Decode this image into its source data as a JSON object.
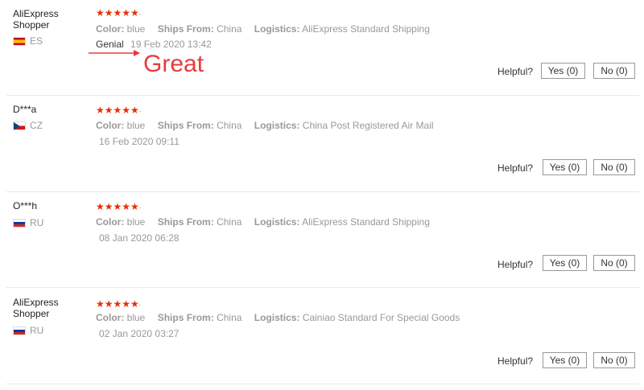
{
  "reviews": [
    {
      "user": "AliExpress\nShopper",
      "country_code": "ES",
      "rating_display": "★★★★★",
      "color_label": "Color:",
      "color_value": "blue",
      "ships_label": "Ships From:",
      "ships_value": "China",
      "logistics_label": "Logistics:",
      "logistics_value": "AliExpress Standard Shipping",
      "feedback_text": "Genial",
      "date": "19 Feb 2020 13:42",
      "helpful_label": "Helpful?",
      "yes_label": "Yes (0)",
      "no_label": "No (0)"
    },
    {
      "user": "D***a",
      "country_code": "CZ",
      "rating_display": "★★★★★",
      "color_label": "Color:",
      "color_value": "blue",
      "ships_label": "Ships From:",
      "ships_value": "China",
      "logistics_label": "Logistics:",
      "logistics_value": "China Post Registered Air Mail",
      "feedback_text": "",
      "date": "16 Feb 2020 09:11",
      "helpful_label": "Helpful?",
      "yes_label": "Yes (0)",
      "no_label": "No (0)"
    },
    {
      "user": "O***h",
      "country_code": "RU",
      "rating_display": "★★★★★",
      "color_label": "Color:",
      "color_value": "blue",
      "ships_label": "Ships From:",
      "ships_value": "China",
      "logistics_label": "Logistics:",
      "logistics_value": "AliExpress Standard Shipping",
      "feedback_text": "",
      "date": "08 Jan 2020 06:28",
      "helpful_label": "Helpful?",
      "yes_label": "Yes (0)",
      "no_label": "No (0)"
    },
    {
      "user": "AliExpress\nShopper",
      "country_code": "RU",
      "rating_display": "★★★★★",
      "color_label": "Color:",
      "color_value": "blue",
      "ships_label": "Ships From:",
      "ships_value": "China",
      "logistics_label": "Logistics:",
      "logistics_value": "Cainiao Standard For Special Goods",
      "feedback_text": "",
      "date": "02 Jan 2020 03:27",
      "helpful_label": "Helpful?",
      "yes_label": "Yes (0)",
      "no_label": "No (0)"
    }
  ],
  "annotation": {
    "text": "Great",
    "color": "#e83a3a",
    "arrow": "arrow-right-icon"
  },
  "colors": {
    "star": "#e62e04",
    "divider": "#e8e8e8"
  }
}
